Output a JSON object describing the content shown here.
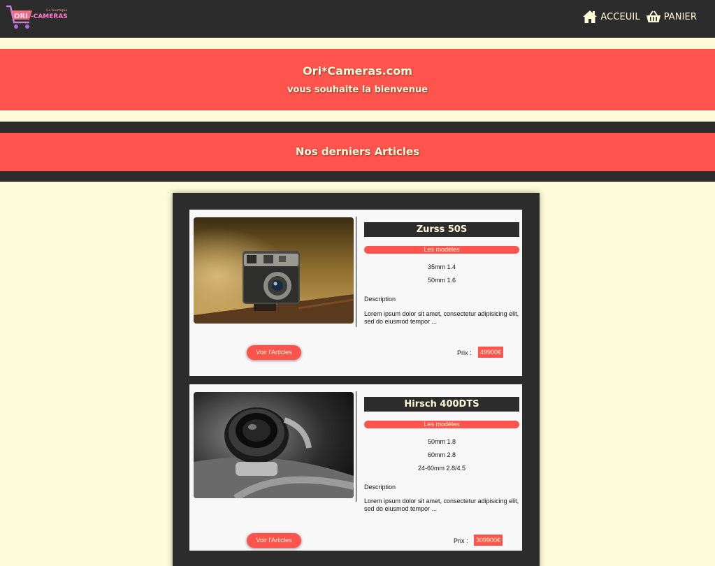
{
  "header": {
    "logo_text": "ORI-CAMERAS",
    "nav": [
      {
        "label": "ACCEUIL",
        "icon": "home-icon"
      },
      {
        "label": "PANIER",
        "icon": "basket-icon"
      }
    ]
  },
  "welcome": {
    "title": "Ori*Cameras.com",
    "subtitle": "vous souhaite la bienvenue"
  },
  "section": {
    "title": "Nos derniers Articles"
  },
  "articles": [
    {
      "name": "Zurss 50S",
      "models_label": "Les modèles",
      "models": [
        "35mm 1.4",
        "50mm 1.6"
      ],
      "description_label": "Description",
      "description": "Lorem ipsum dolor sit amet, consectetur adipisicing elit, sed do eiusmod tempor ...",
      "button_label": "Voir l'Articles",
      "price_label": "Prix :",
      "price": "49900€"
    },
    {
      "name": "Hirsch 400DTS",
      "models_label": "Les modèles",
      "models": [
        "50mm 1.8",
        "60mm 2.8",
        "24-60mm 2.8/4.5"
      ],
      "description_label": "Description",
      "description": "Lorem ipsum dolor sit amet, consectetur adipisicing elit, sed do eiusmod tempor ...",
      "button_label": "Voir l'Articles",
      "price_label": "Prix :",
      "price": "309900€"
    }
  ],
  "colors": {
    "accent": "#ff544d",
    "dark": "#2c2c2c",
    "cream": "#fefbd8"
  }
}
